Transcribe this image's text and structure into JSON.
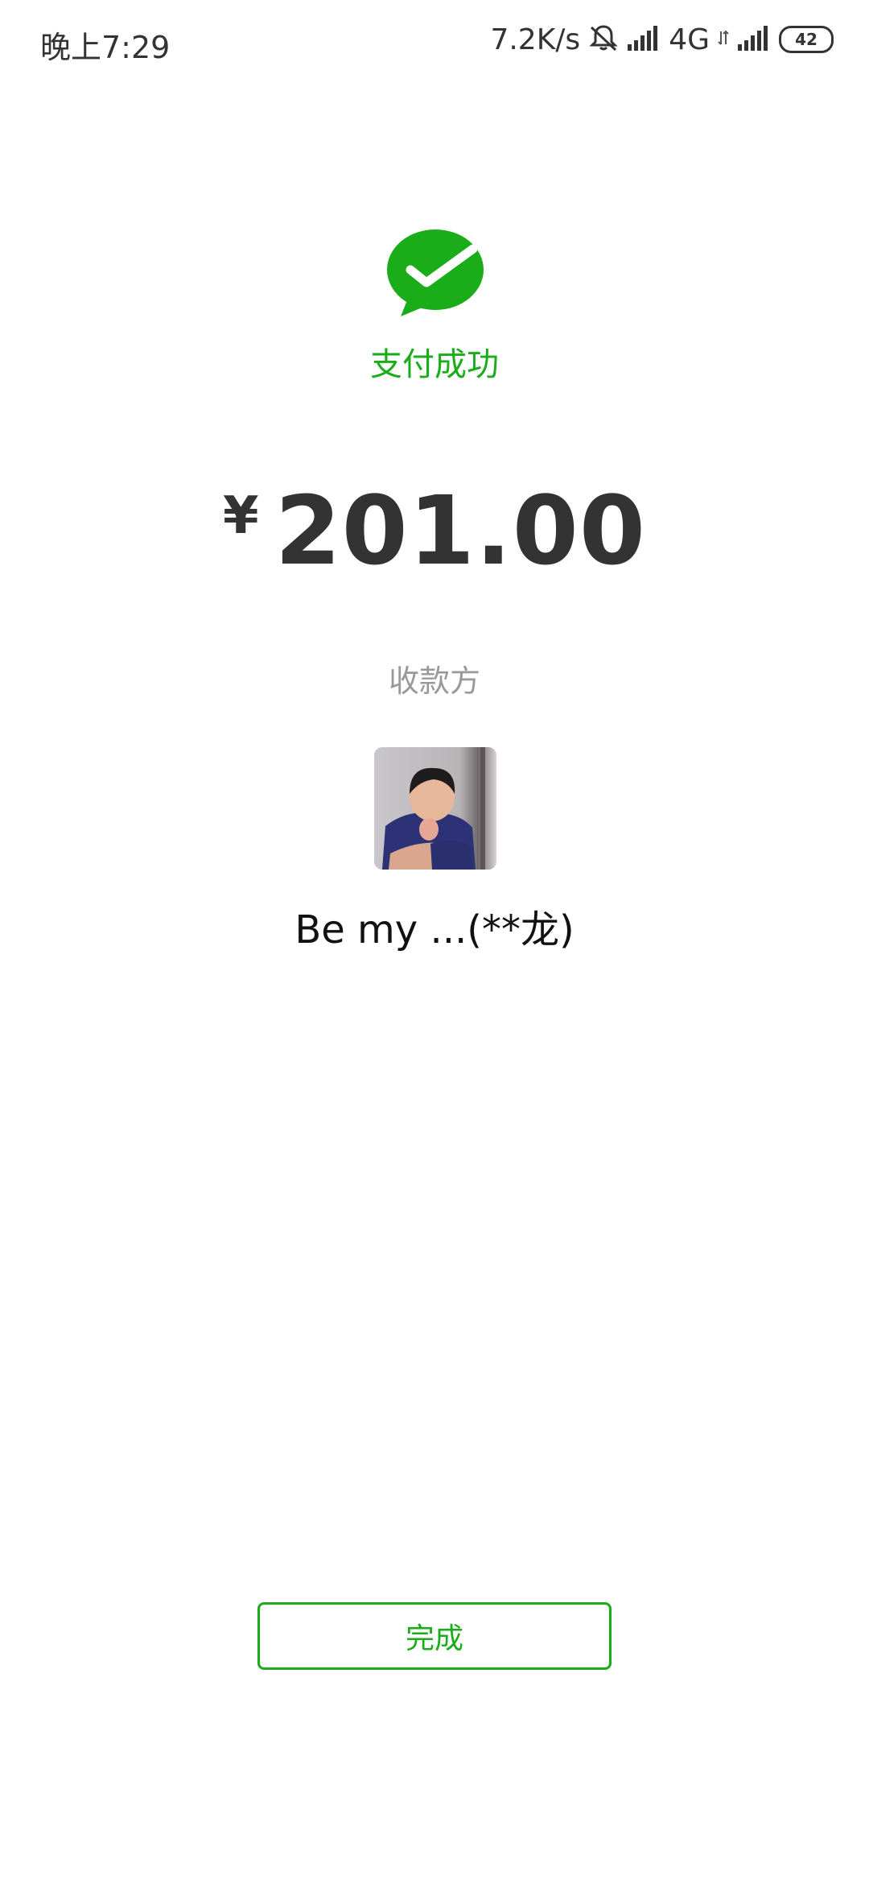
{
  "status_bar": {
    "time": "晚上7:29",
    "net_speed": "7.2K/s",
    "network_type": "4G",
    "battery": "42",
    "icons": [
      "bell-off-icon",
      "signal-icon",
      "signal-icon"
    ]
  },
  "payment": {
    "status_text": "支付成功",
    "currency_symbol": "¥",
    "amount": "201.00",
    "payee_label": "收款方",
    "payee_name": "Be my ...(**龙)"
  },
  "actions": {
    "done_label": "完成"
  },
  "colors": {
    "accent": "#1aad19",
    "text_primary": "#333333",
    "text_secondary": "#999999"
  }
}
